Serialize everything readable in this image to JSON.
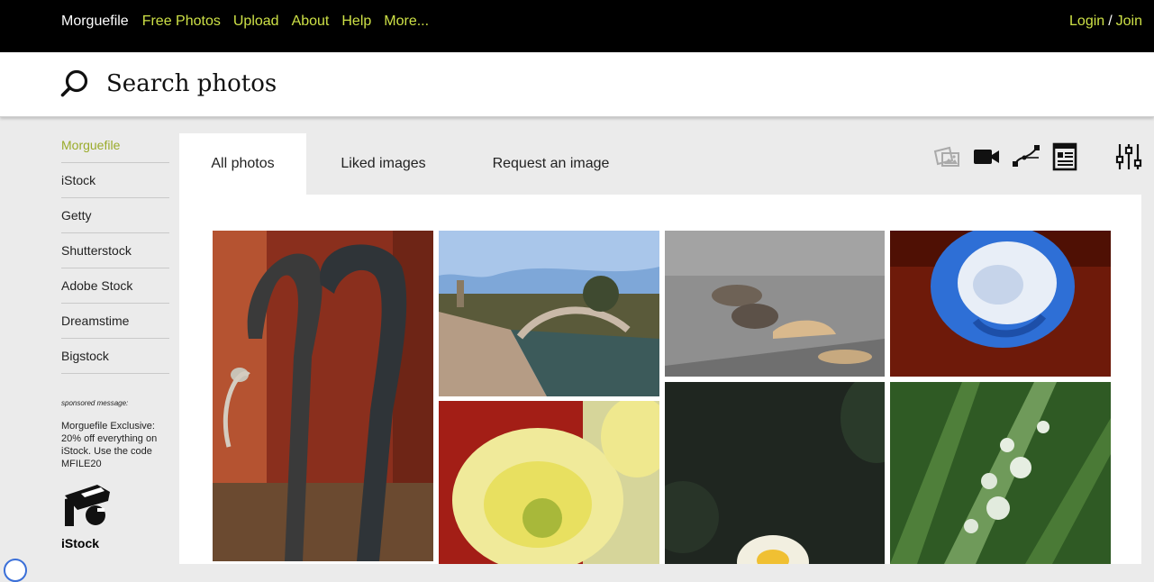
{
  "nav": {
    "brand": "Morguefile",
    "links": [
      "Free Photos",
      "Upload",
      "About",
      "Help",
      "More..."
    ],
    "login": "Login",
    "separator": "/",
    "join": "Join"
  },
  "search": {
    "placeholder": "Search photos",
    "icon": "search-icon"
  },
  "sidebar": {
    "items": [
      {
        "label": "Morguefile",
        "active": true
      },
      {
        "label": "iStock"
      },
      {
        "label": "Getty"
      },
      {
        "label": "Shutterstock"
      },
      {
        "label": "Adobe Stock"
      },
      {
        "label": "Dreamstime"
      },
      {
        "label": "Bigstock"
      }
    ],
    "sponsor_label": "sponsored message:",
    "sponsor_text": "Morguefile Exclusive: 20% off everything on iStock. Use the code MFILE20",
    "sponsor_brand": "iStock"
  },
  "tabs": [
    {
      "label": "All photos",
      "active": true
    },
    {
      "label": "Liked images"
    },
    {
      "label": "Request an image"
    }
  ],
  "tools": [
    "photos-icon",
    "video-icon",
    "vector-icon",
    "layout-icon",
    "filter-sliders-icon"
  ],
  "photos": [
    {
      "subject": "snake-sculptures"
    },
    {
      "subject": "stone-bridge-canal"
    },
    {
      "subject": "sparrows-bread"
    },
    {
      "subject": "blue-white-rose"
    },
    {
      "subject": "yellow-chrysanthemum"
    },
    {
      "subject": "water-lily"
    },
    {
      "subject": "dew-on-grass"
    }
  ],
  "colors": {
    "accent": "#cde046",
    "active_sidebar": "#9aab2a",
    "topbar": "#000000"
  }
}
